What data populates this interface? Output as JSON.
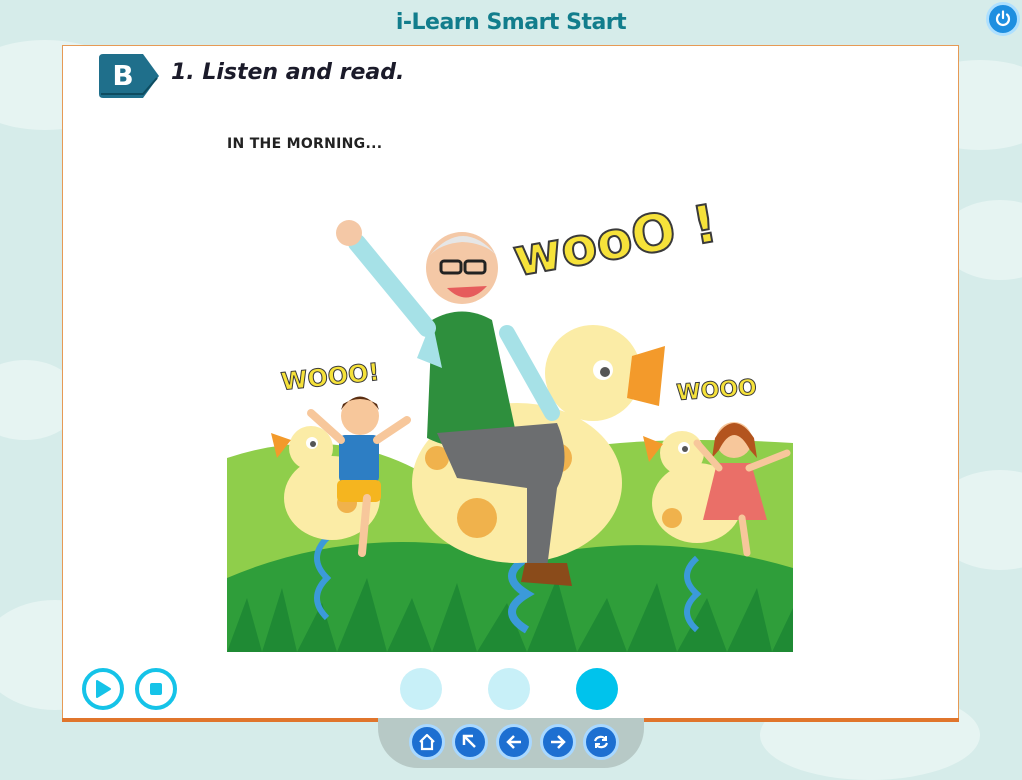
{
  "app": {
    "title": "i-Learn Smart Start"
  },
  "header": {
    "power_icon": "power-icon"
  },
  "lesson": {
    "section_letter": "B",
    "instruction": "1. Listen and read.",
    "caption": "IN THE MORNING...",
    "illustration": {
      "shout_main": "wooO !",
      "shout_left": "WOOO!",
      "shout_right": "WOOO"
    }
  },
  "controls": {
    "play_icon": "play-icon",
    "stop_icon": "stop-icon",
    "page_dots": [
      {
        "state": "inactive"
      },
      {
        "state": "inactive"
      },
      {
        "state": "active"
      }
    ]
  },
  "navigation": [
    {
      "icon": "home-icon"
    },
    {
      "icon": "arrow-up-left-icon"
    },
    {
      "icon": "arrow-left-icon"
    },
    {
      "icon": "arrow-right-icon"
    },
    {
      "icon": "refresh-icon"
    }
  ],
  "colors": {
    "accent": "#15c3e8",
    "title": "#127d8c",
    "badge": "#1f6f8b",
    "frame": "#e69a55",
    "nav_button": "#1d6fd1",
    "power_button": "#1e8fe0"
  }
}
